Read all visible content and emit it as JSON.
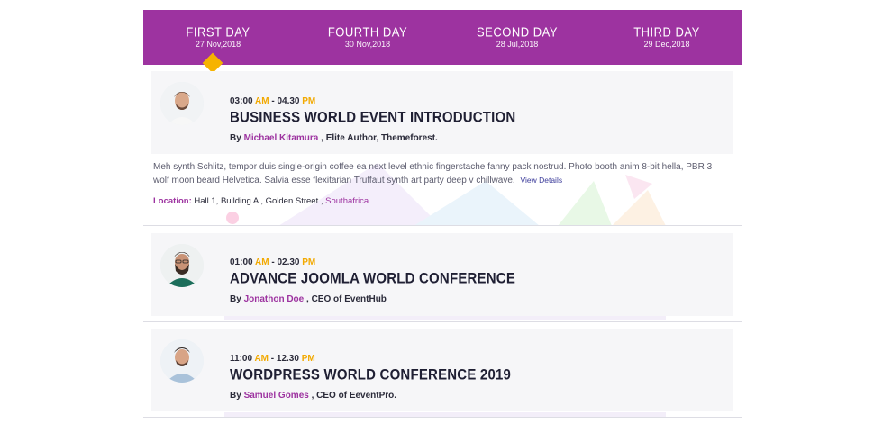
{
  "tabs": [
    {
      "name": "FIRST DAY",
      "date": "27 Nov,2018",
      "active": true
    },
    {
      "name": "FOURTH DAY",
      "date": "30 Nov,2018",
      "active": false
    },
    {
      "name": "SECOND DAY",
      "date": "28 Jul,2018",
      "active": false
    },
    {
      "name": "THIRD DAY",
      "date": "29 Dec,2018",
      "active": false
    }
  ],
  "events": [
    {
      "start": "03:00",
      "start_ampm": "AM",
      "sep": " - ",
      "end": "04.30",
      "end_ampm": "PM",
      "title": "BUSINESS WORLD EVENT INTRODUCTION",
      "by": "By ",
      "author": "Michael Kitamura",
      "role": " , Elite Author, Themeforest.",
      "description": "Meh synth Schlitz, tempor duis single-origin coffee ea next level ethnic fingerstache fanny pack nostrud. Photo booth anim 8-bit hella, PBR 3 wolf moon beard Helvetica. Salvia esse flexitarian Truffaut synth art party deep v chillwave.",
      "view_details": "View Details",
      "location_label": "Location:",
      "location_text": " Hall 1, Building A , Golden Street , ",
      "location_city": "Southafrica"
    },
    {
      "start": "01:00",
      "start_ampm": "AM",
      "sep": " - ",
      "end": "02.30",
      "end_ampm": "PM",
      "title": "ADVANCE JOOMLA WORLD CONFERENCE",
      "by": "By ",
      "author": "Jonathon Doe",
      "role": " , CEO of EventHub"
    },
    {
      "start": "11:00",
      "start_ampm": "AM",
      "sep": " - ",
      "end": "12.30",
      "end_ampm": "PM",
      "title": "WORDPRESS WORLD CONFERENCE 2019",
      "by": "By ",
      "author": "Samuel Gomes",
      "role": " , CEO of EeventPro."
    }
  ],
  "colors": {
    "brand": "#9d33a0",
    "accent": "#f6b300",
    "card": "#f6f6f8"
  }
}
